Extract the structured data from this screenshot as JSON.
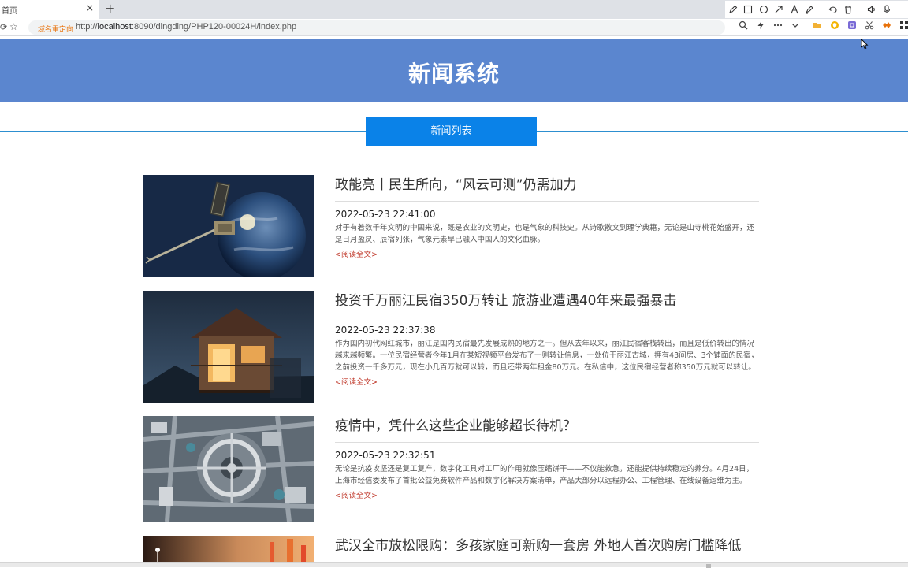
{
  "browser": {
    "tab_title": "首页",
    "tab_close": "×",
    "new_tab": "+",
    "redirect_tag": "域名重定向",
    "url_prefix": "http://",
    "url_host": "localhost",
    "url_rest": ":8090/dingding/PHP120-00024H/index.php",
    "annotation_tools": [
      "pencil-icon",
      "rectangle-icon",
      "circle-icon",
      "arrow-icon",
      "text-icon",
      "highlighter-icon",
      "undo-icon",
      "trash-icon",
      "speaker-icon",
      "microphone-icon"
    ],
    "address_actions": [
      "zoom-icon",
      "lightning-icon",
      "more-icon",
      "chevron-down-icon"
    ],
    "extensions": [
      "folder-extension-icon",
      "shield-extension-icon",
      "grid-extension-icon",
      "scissors-extension-icon",
      "script-extension-icon",
      "apps-icon"
    ]
  },
  "header": {
    "title": "新闻系统",
    "background": "#5b86cf"
  },
  "section": {
    "tab_label": "新闻列表",
    "accent": "#0a82e8"
  },
  "news": [
    {
      "title": "政能亮丨民生所向，“风云可测”仍需加力",
      "date": "2022-05-23 22:41:00",
      "summary": "对于有着数千年文明的中国来说，既是农业的文明史，也是气象的科技史。从诗歌散文到理学典籍，无论是山寺桃花始盛开，还是日月盈昃、辰宿列张，气象元素早已融入中国人的文化血脉。",
      "read_more": "<阅读全文>",
      "image": "satellite-over-earth"
    },
    {
      "title": "投资千万丽江民宿350万转让 旅游业遭遇40年来最强暴击",
      "date": "2022-05-23 22:37:38",
      "summary": "作为国内初代网红城市，丽江是国内民宿最先发展成熟的地方之一。但从去年以来，丽江民宿客栈转出，而且是低价转出的情况越来越频繁。一位民宿经营者今年1月在某短视频平台发布了一则转让信息，一处位于丽江古城，拥有43间房、3个铺面的民宿，之前投资一千多万元，现在小几百万就可以转，而且还带两年租金80万元。在私信中，这位民宿经营者称350万元就可以转让。",
      "read_more": "<阅读全文>",
      "image": "wooden-guesthouse"
    },
    {
      "title": "疫情中，凭什么这些企业能够超长待机？",
      "date": "2022-05-23 22:32:51",
      "summary": "无论是抗疫攻坚还是复工复产，数字化工具对工厂的作用就像压缩饼干——不仅能救急，还能提供持续稳定的养分。4月24日，上海市经信委发布了首批公益免费软件产品和数字化解决方案清单，产品大部分以远程办公、工程管理、在线设备运维为主。",
      "read_more": "<阅读全文>",
      "image": "aerial-city-roundabout"
    },
    {
      "title": "武汉全市放松限购：多孩家庭可新购一套房 外地人首次购房门槛降低",
      "date": "",
      "summary": "",
      "read_more": "",
      "image": "warm-lights"
    }
  ]
}
